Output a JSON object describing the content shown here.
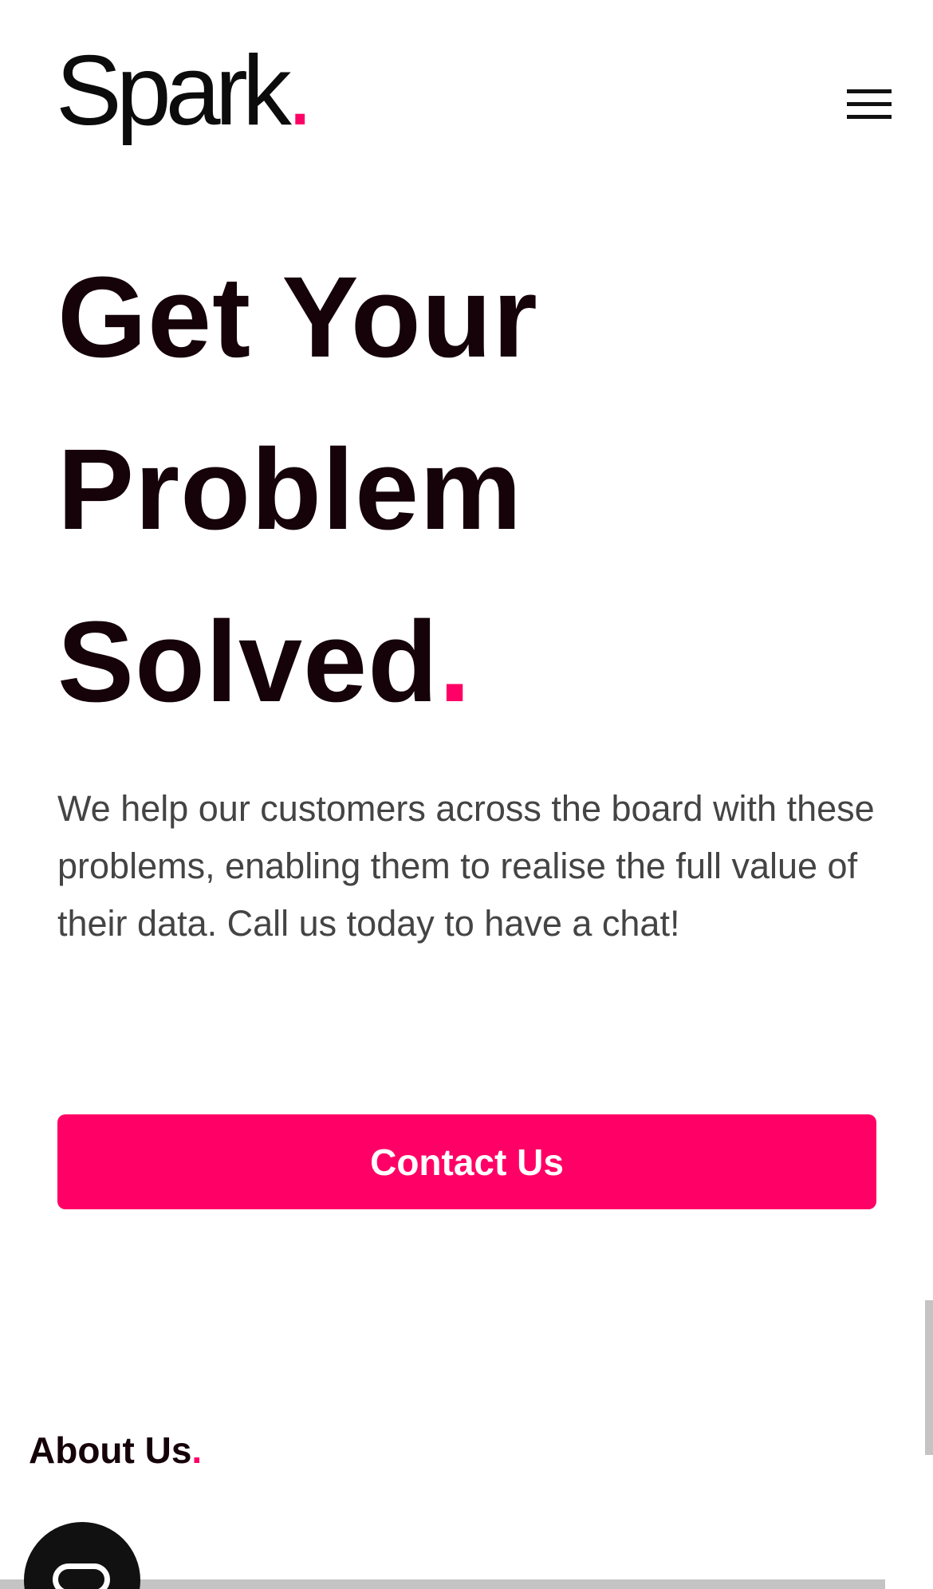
{
  "brand": {
    "logo_text": "Spark",
    "logo_dot": ".",
    "accent_color": "#ff0066"
  },
  "header": {
    "menu_icon": "hamburger-menu-icon"
  },
  "hero": {
    "title_lines": [
      "Get Your",
      "Problem",
      "Solved"
    ],
    "title_dot": ".",
    "description": "We help our customers across the board with these problems, enabling them to realise the full value of their data. Call us today to have a chat!",
    "cta_label": "Contact Us"
  },
  "about": {
    "title": "About Us",
    "title_dot": "."
  },
  "chat_widget": {
    "icon": "chat-icon"
  }
}
